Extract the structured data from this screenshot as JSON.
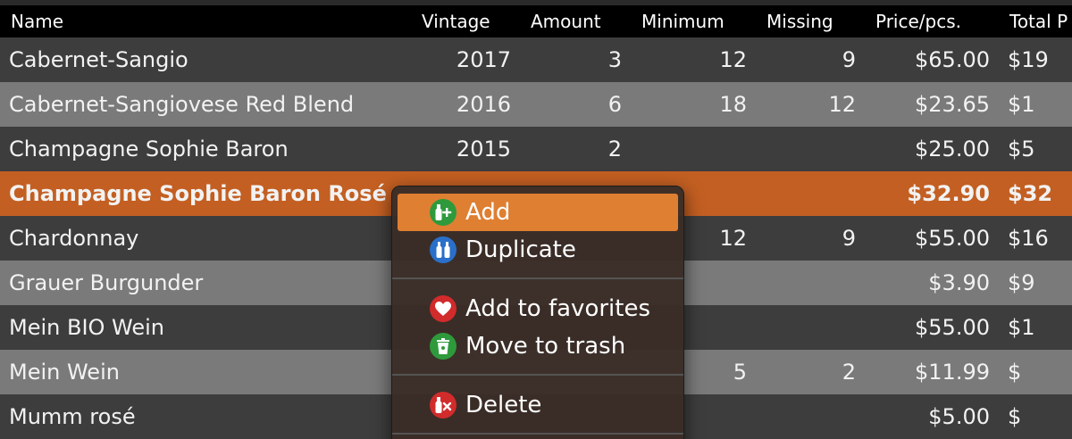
{
  "table": {
    "columns": {
      "name": "Name",
      "vintage": "Vintage",
      "amount": "Amount",
      "minimum": "Minimum",
      "missing": "Missing",
      "price": "Price/pcs.",
      "total": "Total P"
    },
    "rows": [
      {
        "name": "Cabernet-Sangio",
        "vintage": "2017",
        "amount": "3",
        "minimum": "12",
        "missing": "9",
        "price": "$65.00",
        "total": "$19"
      },
      {
        "name": "Cabernet-Sangiovese Red Blend",
        "vintage": "2016",
        "amount": "6",
        "minimum": "18",
        "missing": "12",
        "price": "$23.65",
        "total": "$1"
      },
      {
        "name": "Champagne Sophie Baron",
        "vintage": "2015",
        "amount": "2",
        "minimum": "",
        "missing": "",
        "price": "$25.00",
        "total": "$5"
      },
      {
        "name": "Champagne Sophie Baron Rosé",
        "vintage": "",
        "amount": "",
        "minimum": "",
        "missing": "",
        "price": "$32.90",
        "total": "$32"
      },
      {
        "name": "Chardonnay",
        "vintage": "",
        "amount": "",
        "minimum": "12",
        "missing": "9",
        "price": "$55.00",
        "total": "$16"
      },
      {
        "name": "Grauer Burgunder",
        "vintage": "",
        "amount": "",
        "minimum": "",
        "missing": "",
        "price": "$3.90",
        "total": "$9"
      },
      {
        "name": "Mein BIO Wein",
        "vintage": "",
        "amount": "",
        "minimum": "",
        "missing": "",
        "price": "$55.00",
        "total": "$1"
      },
      {
        "name": "Mein Wein",
        "vintage": "",
        "amount": "",
        "minimum": "5",
        "missing": "2",
        "price": "$11.99",
        "total": "$"
      },
      {
        "name": "Mumm rosé",
        "vintage": "",
        "amount": "",
        "minimum": "",
        "missing": "",
        "price": "$5.00",
        "total": "$"
      }
    ]
  },
  "context_menu": {
    "add": "Add",
    "duplicate": "Duplicate",
    "add_favorites": "Add to favorites",
    "move_trash": "Move to trash",
    "delete": "Delete"
  },
  "colors": {
    "selected_row": "#c35f22",
    "menu_highlight": "#df7f32",
    "icon_green": "#2e9a3c",
    "icon_blue": "#2a6fc9",
    "icon_red": "#d12b2b"
  },
  "icons": {
    "add": "add-bottle-icon",
    "duplicate": "duplicate-bottles-icon",
    "favorites": "heart-icon",
    "trash": "trash-icon",
    "delete": "delete-bottle-icon"
  }
}
